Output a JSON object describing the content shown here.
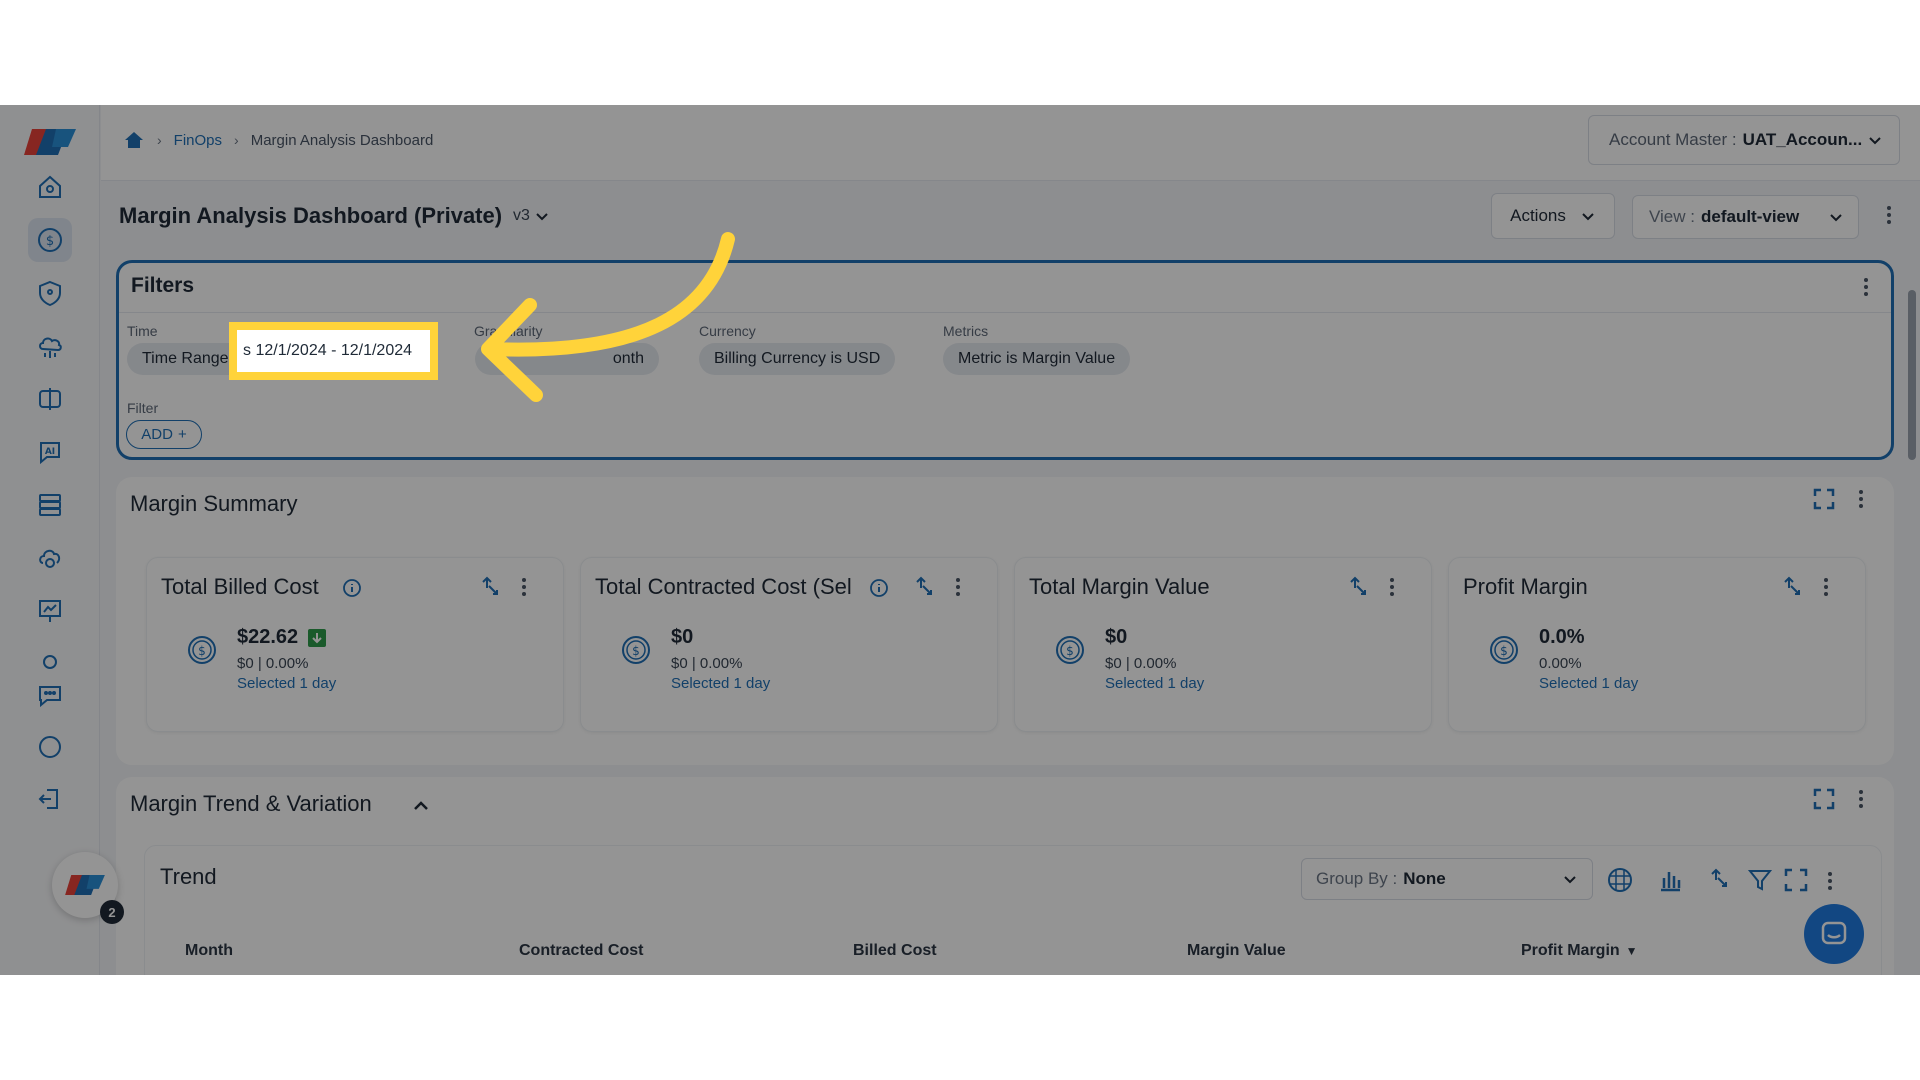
{
  "breadcrumb": {
    "home_icon": "home-icon",
    "finops": "FinOps",
    "current": "Margin Analysis Dashboard"
  },
  "account": {
    "label": "Account Master :",
    "value": "UAT_Accoun..."
  },
  "page": {
    "title": "Margin Analysis Dashboard (Private)",
    "version": "v3"
  },
  "toolbar": {
    "actions": "Actions",
    "view_label": "View :",
    "view_value": "default-view"
  },
  "filters": {
    "title": "Filters",
    "time_label": "Time",
    "time_chip_prefix": "Time Range",
    "time_chip_value": "s 12/1/2024 - 12/1/2024",
    "granularity_label": "Granularity",
    "granularity_chip": "onth",
    "currency_label": "Currency",
    "currency_chip": "Billing Currency is USD",
    "metrics_label": "Metrics",
    "metrics_chip": "Metric is Margin Value",
    "filter_label": "Filter",
    "add": "ADD"
  },
  "summary": {
    "title": "Margin Summary",
    "cards": [
      {
        "title": "Total Billed Cost",
        "value": "$22.62",
        "sub": "$0 | 0.00%",
        "sel": "Selected 1 day"
      },
      {
        "title": "Total Contracted Cost (Sel",
        "value": "$0",
        "sub": "$0 | 0.00%",
        "sel": "Selected 1 day"
      },
      {
        "title": "Total Margin Value",
        "value": "$0",
        "sub": "$0 | 0.00%",
        "sel": "Selected 1 day"
      },
      {
        "title": "Profit Margin",
        "value": "0.0%",
        "sub": "0.00%",
        "sel": "Selected 1 day"
      }
    ]
  },
  "trend_section": {
    "title": "Margin Trend & Variation"
  },
  "trend": {
    "title": "Trend",
    "group_by_label": "Group By :",
    "group_by_value": "None",
    "columns": [
      "Month",
      "Contracted Cost",
      "Billed Cost",
      "Margin Value",
      "Profit Margin"
    ]
  },
  "notifications": {
    "count": "2"
  },
  "colors": {
    "accent": "#1f6fb5",
    "highlight": "#ffd33a",
    "down_badge": "#2e9b4a"
  }
}
